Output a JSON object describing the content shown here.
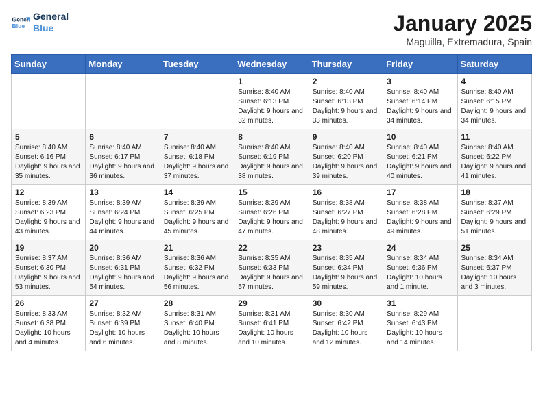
{
  "logo": {
    "line1": "General",
    "line2": "Blue"
  },
  "header": {
    "month": "January 2025",
    "location": "Maguilla, Extremadura, Spain"
  },
  "weekdays": [
    "Sunday",
    "Monday",
    "Tuesday",
    "Wednesday",
    "Thursday",
    "Friday",
    "Saturday"
  ],
  "weeks": [
    [
      {
        "day": "",
        "info": ""
      },
      {
        "day": "",
        "info": ""
      },
      {
        "day": "",
        "info": ""
      },
      {
        "day": "1",
        "info": "Sunrise: 8:40 AM\nSunset: 6:13 PM\nDaylight: 9 hours and 32 minutes."
      },
      {
        "day": "2",
        "info": "Sunrise: 8:40 AM\nSunset: 6:13 PM\nDaylight: 9 hours and 33 minutes."
      },
      {
        "day": "3",
        "info": "Sunrise: 8:40 AM\nSunset: 6:14 PM\nDaylight: 9 hours and 34 minutes."
      },
      {
        "day": "4",
        "info": "Sunrise: 8:40 AM\nSunset: 6:15 PM\nDaylight: 9 hours and 34 minutes."
      }
    ],
    [
      {
        "day": "5",
        "info": "Sunrise: 8:40 AM\nSunset: 6:16 PM\nDaylight: 9 hours and 35 minutes."
      },
      {
        "day": "6",
        "info": "Sunrise: 8:40 AM\nSunset: 6:17 PM\nDaylight: 9 hours and 36 minutes."
      },
      {
        "day": "7",
        "info": "Sunrise: 8:40 AM\nSunset: 6:18 PM\nDaylight: 9 hours and 37 minutes."
      },
      {
        "day": "8",
        "info": "Sunrise: 8:40 AM\nSunset: 6:19 PM\nDaylight: 9 hours and 38 minutes."
      },
      {
        "day": "9",
        "info": "Sunrise: 8:40 AM\nSunset: 6:20 PM\nDaylight: 9 hours and 39 minutes."
      },
      {
        "day": "10",
        "info": "Sunrise: 8:40 AM\nSunset: 6:21 PM\nDaylight: 9 hours and 40 minutes."
      },
      {
        "day": "11",
        "info": "Sunrise: 8:40 AM\nSunset: 6:22 PM\nDaylight: 9 hours and 41 minutes."
      }
    ],
    [
      {
        "day": "12",
        "info": "Sunrise: 8:39 AM\nSunset: 6:23 PM\nDaylight: 9 hours and 43 minutes."
      },
      {
        "day": "13",
        "info": "Sunrise: 8:39 AM\nSunset: 6:24 PM\nDaylight: 9 hours and 44 minutes."
      },
      {
        "day": "14",
        "info": "Sunrise: 8:39 AM\nSunset: 6:25 PM\nDaylight: 9 hours and 45 minutes."
      },
      {
        "day": "15",
        "info": "Sunrise: 8:39 AM\nSunset: 6:26 PM\nDaylight: 9 hours and 47 minutes."
      },
      {
        "day": "16",
        "info": "Sunrise: 8:38 AM\nSunset: 6:27 PM\nDaylight: 9 hours and 48 minutes."
      },
      {
        "day": "17",
        "info": "Sunrise: 8:38 AM\nSunset: 6:28 PM\nDaylight: 9 hours and 49 minutes."
      },
      {
        "day": "18",
        "info": "Sunrise: 8:37 AM\nSunset: 6:29 PM\nDaylight: 9 hours and 51 minutes."
      }
    ],
    [
      {
        "day": "19",
        "info": "Sunrise: 8:37 AM\nSunset: 6:30 PM\nDaylight: 9 hours and 53 minutes."
      },
      {
        "day": "20",
        "info": "Sunrise: 8:36 AM\nSunset: 6:31 PM\nDaylight: 9 hours and 54 minutes."
      },
      {
        "day": "21",
        "info": "Sunrise: 8:36 AM\nSunset: 6:32 PM\nDaylight: 9 hours and 56 minutes."
      },
      {
        "day": "22",
        "info": "Sunrise: 8:35 AM\nSunset: 6:33 PM\nDaylight: 9 hours and 57 minutes."
      },
      {
        "day": "23",
        "info": "Sunrise: 8:35 AM\nSunset: 6:34 PM\nDaylight: 9 hours and 59 minutes."
      },
      {
        "day": "24",
        "info": "Sunrise: 8:34 AM\nSunset: 6:36 PM\nDaylight: 10 hours and 1 minute."
      },
      {
        "day": "25",
        "info": "Sunrise: 8:34 AM\nSunset: 6:37 PM\nDaylight: 10 hours and 3 minutes."
      }
    ],
    [
      {
        "day": "26",
        "info": "Sunrise: 8:33 AM\nSunset: 6:38 PM\nDaylight: 10 hours and 4 minutes."
      },
      {
        "day": "27",
        "info": "Sunrise: 8:32 AM\nSunset: 6:39 PM\nDaylight: 10 hours and 6 minutes."
      },
      {
        "day": "28",
        "info": "Sunrise: 8:31 AM\nSunset: 6:40 PM\nDaylight: 10 hours and 8 minutes."
      },
      {
        "day": "29",
        "info": "Sunrise: 8:31 AM\nSunset: 6:41 PM\nDaylight: 10 hours and 10 minutes."
      },
      {
        "day": "30",
        "info": "Sunrise: 8:30 AM\nSunset: 6:42 PM\nDaylight: 10 hours and 12 minutes."
      },
      {
        "day": "31",
        "info": "Sunrise: 8:29 AM\nSunset: 6:43 PM\nDaylight: 10 hours and 14 minutes."
      },
      {
        "day": "",
        "info": ""
      }
    ]
  ]
}
